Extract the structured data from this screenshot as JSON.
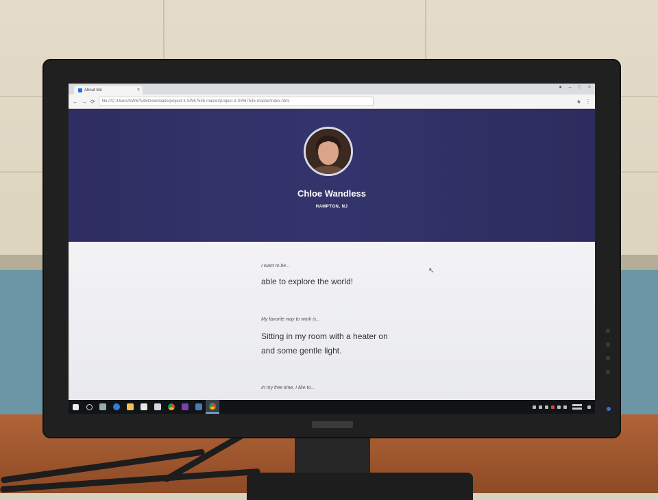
{
  "browser": {
    "tab_title": "About Me",
    "url": "file:///C:/Users/SW67535/Downloads/project-3-SW67535-master/project-3-SW67535-master/index.html"
  },
  "profile": {
    "name": "Chloe Wandless",
    "location": "HAMPTON, NJ"
  },
  "sections": [
    {
      "prompt": "I want to be...",
      "answer_lines": [
        "able to explore the world!"
      ]
    },
    {
      "prompt": "My favorite way to work is...",
      "answer_lines": [
        "Sitting in my room with a heater on",
        "and some gentle light."
      ]
    },
    {
      "prompt": "In my free time, I like to..."
    }
  ],
  "colors": {
    "hero_bg": "#2f2e62",
    "page_bg": "#f3f3f6",
    "taskbar_bg": "#101417",
    "desk": "#a85c32",
    "wall_blue": "#6a96a6"
  },
  "icons": [
    "windows-start-icon",
    "search-icon",
    "task-view-icon",
    "edge-icon",
    "folder-icon",
    "store-icon",
    "mail-icon",
    "chrome-icon",
    "onenote-icon",
    "calculator-icon"
  ]
}
